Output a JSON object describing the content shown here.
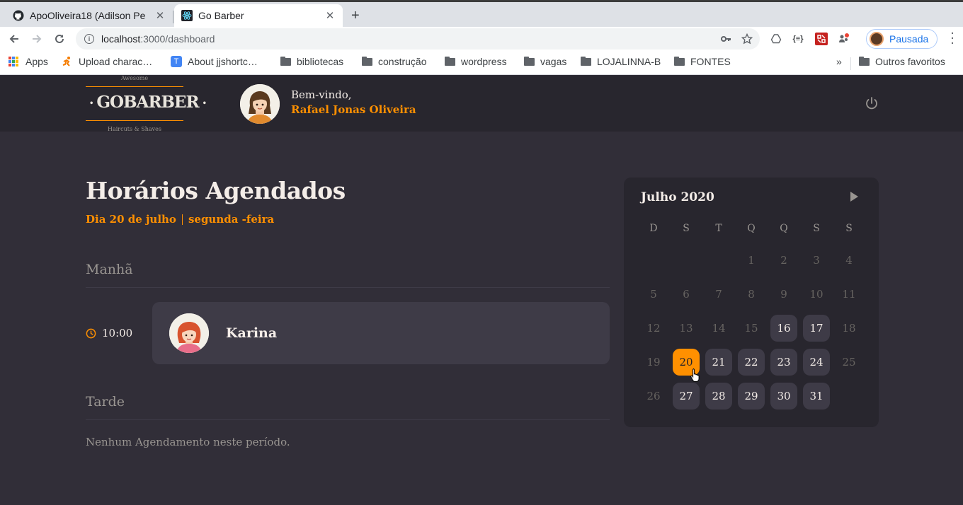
{
  "browser": {
    "tabs": [
      {
        "title": "ApoOliveira18 (Adilson Pe",
        "favicon": "github-icon",
        "active": false
      },
      {
        "title": "Go Barber",
        "favicon": "react-icon",
        "active": true
      }
    ],
    "close_glyph": "✕",
    "newtab_glyph": "+",
    "url_host": "localhost",
    "url_rest": ":3000/dashboard",
    "profile_label": "Pausada",
    "ext_labels": [
      "{≡}"
    ],
    "bookmarks": [
      {
        "label": "Apps",
        "icon": "apps-grid-icon"
      },
      {
        "label": "Upload charac…",
        "icon": "runner-icon"
      },
      {
        "label": "About jjshortc…",
        "icon": "t-favicon-icon"
      },
      {
        "label": "bibliotecas",
        "icon": "folder-icon"
      },
      {
        "label": "construção",
        "icon": "folder-icon"
      },
      {
        "label": "wordpress",
        "icon": "folder-icon"
      },
      {
        "label": "vagas",
        "icon": "folder-icon"
      },
      {
        "label": "LOJALINNA-B",
        "icon": "folder-icon"
      },
      {
        "label": "FONTES",
        "icon": "folder-icon"
      }
    ],
    "more_bookmarks": "»",
    "other_bookmarks": "Outros favoritos"
  },
  "header": {
    "logo_top": "Awesome",
    "logo_main": "GOBARBER",
    "logo_bottom": "Haircuts & Shaves",
    "welcome": "Bem-vindo,",
    "user_name": "Rafael Jonas Oliveira"
  },
  "schedule": {
    "title": "Horários Agendados",
    "day_label": "Dia 20 de julho",
    "weekday_label": "segunda -feira",
    "morning_title": "Manhã",
    "afternoon_title": "Tarde",
    "appointments": [
      {
        "time": "10:00",
        "client": "Karina"
      }
    ],
    "afternoon_empty": "Nenhum Agendamento neste período."
  },
  "calendar": {
    "caption": "Julho 2020",
    "weekdays": [
      "D",
      "S",
      "T",
      "Q",
      "Q",
      "S",
      "S"
    ],
    "first_weekday": 3,
    "days_in_month": 31,
    "available_days": [
      16,
      17,
      21,
      22,
      23,
      24,
      27,
      28,
      29,
      30,
      31
    ],
    "selected_day": 20
  },
  "colors": {
    "accent": "#ff9000",
    "background": "#312e38",
    "header_bg": "#28262e",
    "card_bg": "#3e3b47",
    "text": "#f4ede8",
    "muted": "#999591"
  }
}
